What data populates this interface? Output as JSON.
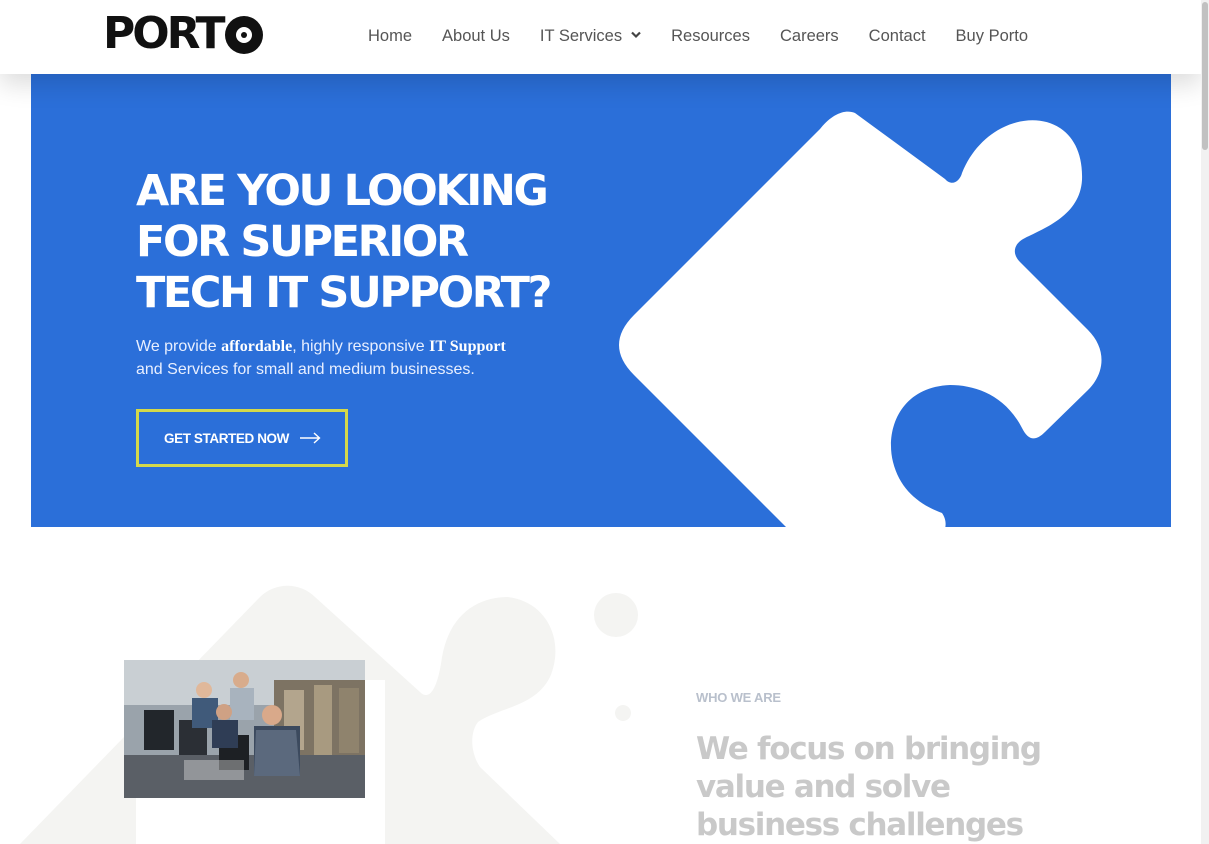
{
  "brand": {
    "logo_text": "PORT",
    "logo_o": "O"
  },
  "nav": {
    "items": [
      {
        "label": "Home"
      },
      {
        "label": "About Us"
      },
      {
        "label": "IT Services",
        "has_dropdown": true,
        "icon": "chevron-down-icon"
      },
      {
        "label": "Resources"
      },
      {
        "label": "Careers"
      },
      {
        "label": "Contact"
      },
      {
        "label": "Buy Porto"
      }
    ]
  },
  "hero": {
    "title_lines": [
      "ARE YOU LOOKING",
      "FOR SUPERIOR",
      "TECH IT SUPPORT?"
    ],
    "sub_1": "We provide ",
    "sub_bold_1": "affordable",
    "sub_2": ", highly responsive ",
    "sub_bold_2": "IT Support",
    "sub_3": "and Services for small and medium businesses.",
    "cta_label": "GET STARTED NOW",
    "cta_icon": "arrow-right-icon",
    "background_color": "#2b6fd9",
    "cta_border_color": "#d4d94a",
    "decoration": "puzzle-piece"
  },
  "about": {
    "kicker": "WHO WE ARE",
    "title_lines": [
      "We focus on bringing",
      "value and solve",
      "business challenges"
    ],
    "photo": "team-working-at-computers"
  }
}
